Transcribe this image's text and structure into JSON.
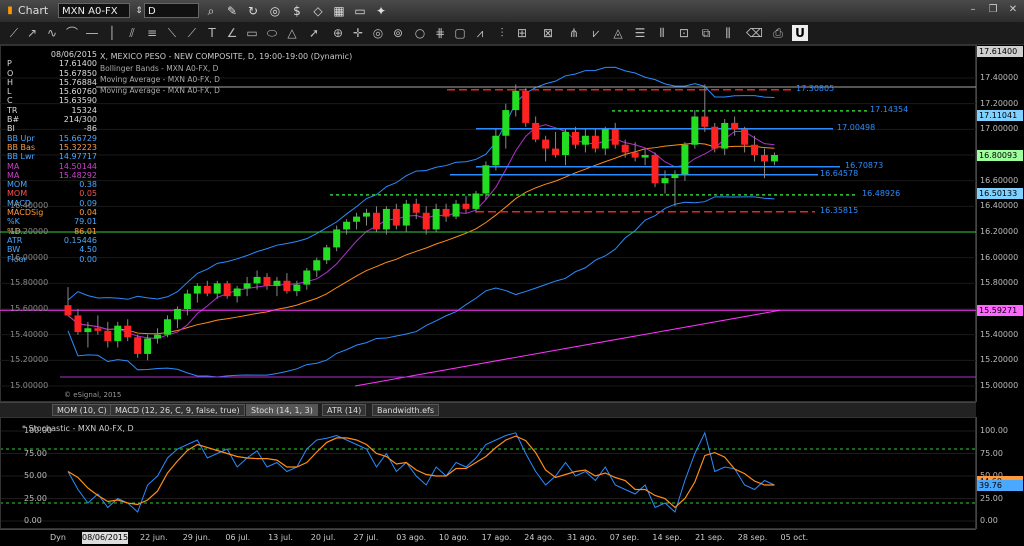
{
  "window": {
    "title": "Chart"
  },
  "toolbar": {
    "symbol": "MXN A0-FX",
    "interval": "D",
    "icons": [
      "search-icon",
      "pencil-icon",
      "refresh-icon",
      "target-icon",
      "dollar-icon",
      "tag-icon",
      "grid-icon",
      "chat-icon",
      "twitter-icon"
    ]
  },
  "window_controls": [
    "minimize",
    "restore",
    "close"
  ],
  "drawbar_icons": [
    "line-icon",
    "ray-icon",
    "pencil-icon",
    "arc-icon",
    "hline-icon",
    "vline-icon",
    "channel-icon",
    "fib-icon",
    "text-icon",
    "circle-icon",
    "cross-icon",
    "rect-icon",
    "ellipse-icon",
    "arrow-icon",
    "zoom-icon",
    "cycle-icon",
    "gann-icon",
    "pitchfork-icon",
    "eraser-icon",
    "print-icon",
    "underline-icon"
  ],
  "chart": {
    "title": "X, MEXICO PESO - NEW COMPOSITE, D, 19:00-19:00 (Dynamic)",
    "legends": [
      "Bollinger Bands - MXN A0-FX, D",
      "Moving Average - MXN A0-FX, D",
      "Moving Average - MXN A0-FX, D"
    ],
    "copyright": "© eSignal, 2015"
  },
  "info_panel": {
    "date": "08/06/2015",
    "rows": [
      {
        "label": "P",
        "value": "17.61400",
        "color": "#dddddd"
      },
      {
        "label": "O",
        "value": "15.67850",
        "color": "#dddddd"
      },
      {
        "label": "H",
        "value": "15.76884",
        "color": "#dddddd"
      },
      {
        "label": "L",
        "value": "15.60760",
        "color": "#dddddd"
      },
      {
        "label": "C",
        "value": "15.63590",
        "color": "#dddddd"
      },
      {
        "label": "TR",
        "value": "15324",
        "color": "#dddddd"
      },
      {
        "label": "B#",
        "value": "214/300",
        "color": "#dddddd"
      },
      {
        "label": "BI",
        "value": "-86",
        "color": "#dddddd"
      },
      {
        "label": "BB Upr",
        "value": "15.66729",
        "color": "#4aa8ff"
      },
      {
        "label": "BB Bas",
        "value": "15.32223",
        "color": "#ff9a3c"
      },
      {
        "label": "BB Lwr",
        "value": "14.97717",
        "color": "#4aa8ff"
      },
      {
        "label": "MA",
        "value": "14.50144",
        "color": "#d040d0"
      },
      {
        "label": "MA",
        "value": "15.48292",
        "color": "#d040d0"
      },
      {
        "label": "MOM",
        "value": "0.38",
        "color": "#4aa8ff"
      },
      {
        "label": "MOM",
        "value": "0.05",
        "color": "#ff5050"
      },
      {
        "label": "MACD",
        "value": "0.09",
        "color": "#4aa8ff"
      },
      {
        "label": "MACDSig",
        "value": "0.04",
        "color": "#ff9a3c"
      },
      {
        "label": "%K",
        "value": "79.01",
        "color": "#4aa8ff"
      },
      {
        "label": "%D",
        "value": "86.01",
        "color": "#ff9a3c"
      },
      {
        "label": "ATR",
        "value": "0.15446",
        "color": "#4aa8ff"
      },
      {
        "label": "BW",
        "value": "4.50",
        "color": "#4aa8ff"
      },
      {
        "label": "Floor",
        "value": "0.00",
        "color": "#4aa8ff"
      }
    ]
  },
  "price_axis": {
    "ticks": [
      "17.40000",
      "17.20000",
      "17.00000",
      "16.80000",
      "16.60000",
      "16.40000",
      "16.20000",
      "16.00000",
      "15.80000",
      "15.60000",
      "15.40000",
      "15.20000",
      "15.00000"
    ],
    "tags": [
      {
        "value": "17.61400",
        "bg": "#cfcfcf",
        "fg": "#000"
      },
      {
        "value": "17.11041",
        "bg": "#7fd1ff",
        "fg": "#000"
      },
      {
        "value": "16.80093",
        "bg": "#9cff9c",
        "fg": "#000"
      },
      {
        "value": "16.50133",
        "bg": "#7fd1ff",
        "fg": "#000"
      },
      {
        "value": "15.59271",
        "bg": "#ff66ff",
        "fg": "#000"
      }
    ]
  },
  "price_levels": [
    {
      "value": "17.30805",
      "color": "#2a8cff"
    },
    {
      "value": "17.14354",
      "color": "#2a8cff"
    },
    {
      "value": "17.00498",
      "color": "#2a8cff"
    },
    {
      "value": "16.70873",
      "color": "#2a8cff"
    },
    {
      "value": "16.64578",
      "color": "#2a8cff"
    },
    {
      "value": "16.48926",
      "color": "#2a8cff"
    },
    {
      "value": "16.35815",
      "color": "#2a8cff"
    }
  ],
  "tabs": [
    "MOM (10, C)",
    "MACD (12, 26, C, 9, false, true)",
    "Stoch (14, 1, 3)",
    "ATR (14)",
    "Bandwidth.efs"
  ],
  "stochastic": {
    "title": "* Stochastic - MXN A0-FX, D",
    "ticks": [
      "100.00",
      "75.00",
      "50.00",
      "25.00",
      "0.00"
    ],
    "tags": [
      {
        "value": "44.60",
        "bg": "#ff9a3c"
      },
      {
        "value": "39.76",
        "bg": "#4aa8ff"
      }
    ]
  },
  "time_axis": {
    "dyn": "Dyn",
    "date": "08/06/2015",
    "labels": [
      "22 jun.",
      "29 jun.",
      "06 jul.",
      "13 jul.",
      "20 jul.",
      "27 jul.",
      "03 ago.",
      "10 ago.",
      "17 ago.",
      "24 ago.",
      "31 ago.",
      "07 sep.",
      "14 sep.",
      "21 sep.",
      "28 sep.",
      "05 oct."
    ]
  }
}
